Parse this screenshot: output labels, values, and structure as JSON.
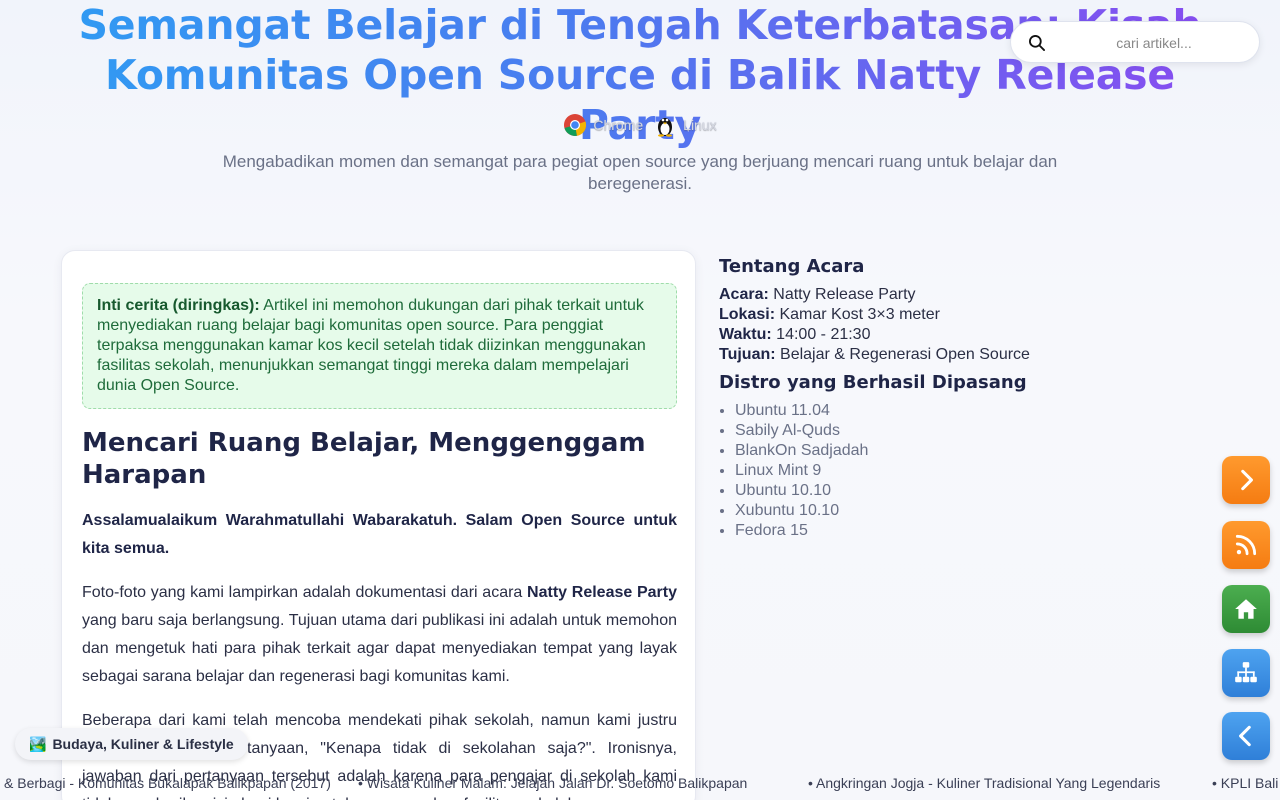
{
  "header": {
    "title": "Semangat Belajar di Tengah Keterbatasan: Kisah Komunitas Open Source di Balik Natty Release Party",
    "subtitle": "Mengabadikan momen dan semangat para pegiat open source yang berjuang mencari ruang untuk belajar dan beregenerasi.",
    "platforms": [
      {
        "label": "Chrome",
        "icon": "chrome-icon"
      },
      {
        "label": "Linux",
        "icon": "tux-icon"
      }
    ]
  },
  "search": {
    "placeholder": "cari artikel..."
  },
  "article": {
    "summary_label": "Inti cerita (diringkas):",
    "summary_text": " Artikel ini memohon dukungan dari pihak terkait untuk menyediakan ruang belajar bagi komunitas open source. Para penggiat terpaksa menggunakan kamar kos kecil setelah tidak diizinkan menggunakan fasilitas sekolah, menunjukkan semangat tinggi mereka dalam mempelajari dunia Open Source.",
    "heading": "Mencari Ruang Belajar, Menggenggam Harapan",
    "greeting": "Assalamualaikum Warahmatullahi Wabarakatuh. Salam Open Source untuk kita semua.",
    "p2_before": "Foto-foto yang kami lampirkan adalah dokumentasi dari acara ",
    "p2_bold": "Natty Release Party",
    "p2_after": " yang baru saja berlangsung. Tujuan utama dari publikasi ini adalah untuk memohon dan mengetuk hati para pihak terkait agar dapat menyediakan tempat yang layak sebagai sarana belajar dan regenerasi bagi komunitas kami.",
    "p3": "Beberapa dari kami telah mencoba mendekati pihak sekolah, namun kami justru dihadapkan pada pertanyaan, \"Kenapa tidak di sekolahan saja?\". Ironisnya, jawaban dari pertanyaan tersebut adalah karena para pengajar di sekolah kami tidak memberikan izin bagi kami untuk menggunakan fasilitas sekolah."
  },
  "sidebar": {
    "about_title": "Tentang Acara",
    "info": [
      {
        "label": "Acara:",
        "value": " Natty Release Party"
      },
      {
        "label": "Lokasi:",
        "value": " Kamar Kost 3×3 meter"
      },
      {
        "label": "Waktu:",
        "value": " 14:00 - 21:30"
      },
      {
        "label": "Tujuan:",
        "value": " Belajar & Regenerasi Open Source"
      }
    ],
    "distro_title": "Distro yang Berhasil Dipasang",
    "distros": [
      "Ubuntu 11.04",
      "Sabily Al-Quds",
      "BlankOn Sadjadah",
      "Linux Mint 9",
      "Ubuntu 10.10",
      "Xubuntu 10.10",
      "Fedora 15"
    ]
  },
  "floating_buttons": [
    {
      "name": "next-button",
      "icon": "chevron-right-icon"
    },
    {
      "name": "rss-button",
      "icon": "rss-icon"
    },
    {
      "name": "home-button",
      "icon": "home-icon"
    },
    {
      "name": "sitemap-button",
      "icon": "sitemap-icon"
    },
    {
      "name": "prev-button",
      "icon": "chevron-left-icon"
    }
  ],
  "category_badge": {
    "emoji": "🏞️",
    "label": "Budaya, Kuliner & Lifestyle"
  },
  "ticker": [
    "& Berbagi - Komunitas Bukalapak Balikpapan (2017)",
    "• Wisata Kuliner Malam: Jelajah Jalan Dr. Soetomo Balikpapan",
    "• Angkringan Jogja - Kuliner Tradisional Yang Legendaris",
    "• KPLI Bali"
  ],
  "colors": {
    "title_start": "#2f9cf3",
    "title_end": "#8a4bf0",
    "summary_bg": "#e6fbea",
    "fab_orange": "#f57c12",
    "fab_green": "#2e8b34",
    "fab_blue": "#2f7fd8"
  }
}
